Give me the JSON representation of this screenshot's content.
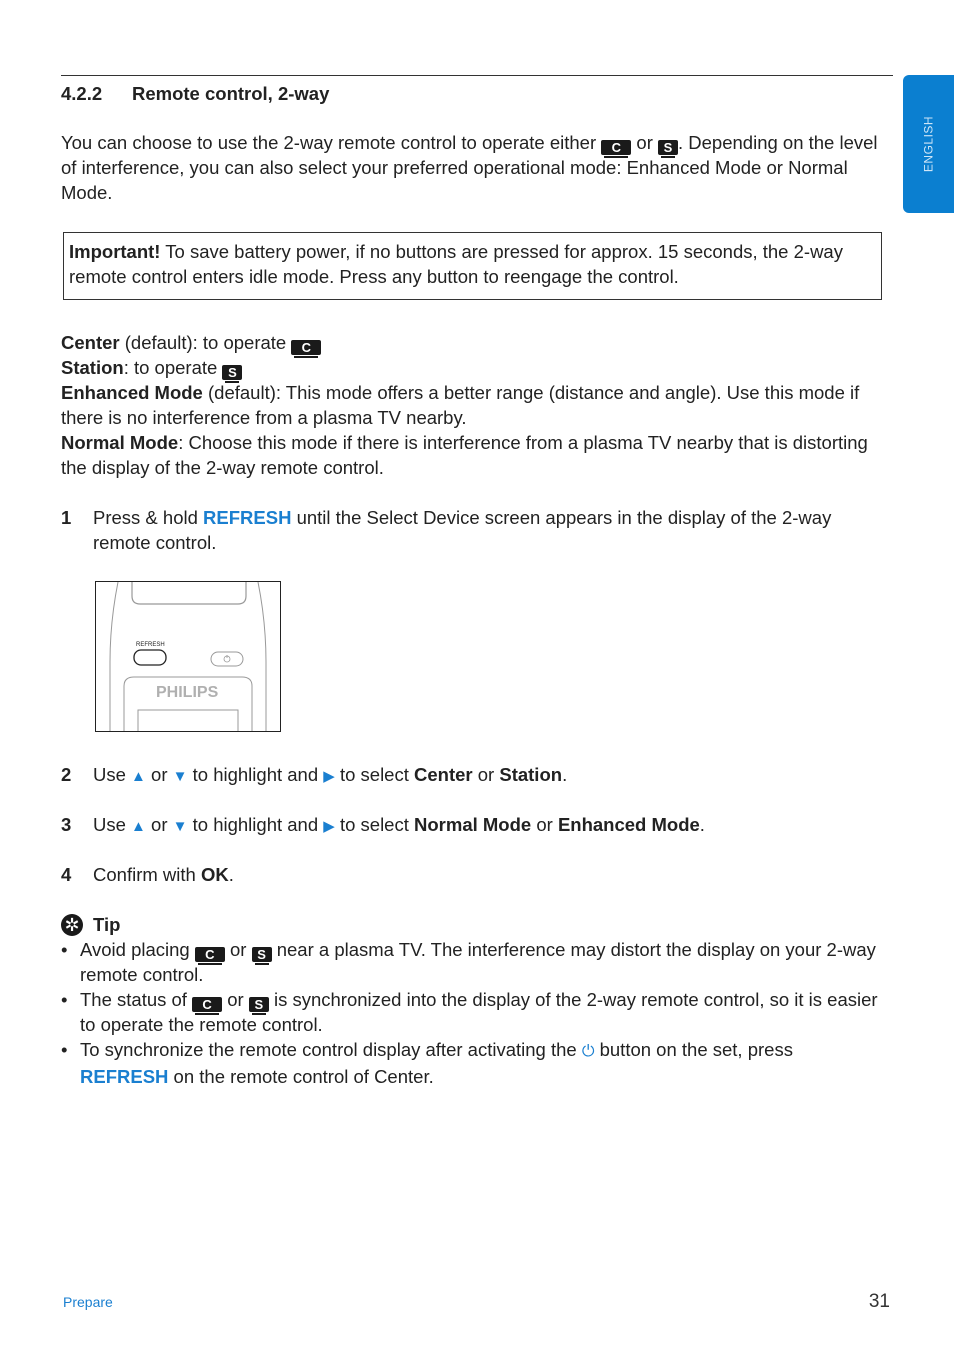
{
  "section": {
    "number": "4.2.2",
    "title": "Remote control, 2-way"
  },
  "language_tab": "ENGLISH",
  "intro": {
    "part1": "You can choose to use the 2-way remote control to operate either",
    "or": "or",
    "part2": ". Depending on the level of interference, you can also select your preferred operational mode: Enhanced Mode or Normal Mode."
  },
  "icons": {
    "center_icon": "C",
    "station_icon": "S",
    "tip_icon": "✲",
    "power_icon": "⏻"
  },
  "important": {
    "label": "Important!",
    "text": " To save battery power, if no buttons are pressed for approx. 15 seconds, the 2-way remote control enters idle mode. Press any button to reengage the control."
  },
  "definitions": {
    "center_label": "Center",
    "center_text": " (default): to operate ",
    "station_label": "Station",
    "station_text": ": to operate ",
    "enhanced_label": "Enhanced Mode",
    "enhanced_text": " (default): This mode offers a better range (distance and angle). Use this mode if there is no interference from a plasma TV nearby.",
    "normal_label": "Normal Mode",
    "normal_text": ": Choose this mode if there is interference from a plasma TV nearby that is distorting the display of the 2-way remote control."
  },
  "steps": [
    {
      "number": "1",
      "pre": "Press & hold ",
      "key": "REFRESH",
      "post": " until the Select Device screen appears in the display of the 2-way remote control."
    },
    {
      "number": "2",
      "use": "Use ",
      "up": "▲",
      "or": " or ",
      "down": "▼",
      "mid": " to highlight and ",
      "right": "▶",
      "select": " to select ",
      "opt1": "Center",
      "or2": " or ",
      "opt2": "Station",
      "end": "."
    },
    {
      "number": "3",
      "use": "Use ",
      "up": "▲",
      "or": " or ",
      "down": "▼",
      "mid": " to highlight and ",
      "right": "▶",
      "select": " to select ",
      "opt1": "Normal Mode",
      "or2": " or ",
      "opt2": "Enhanced Mode",
      "end": "."
    },
    {
      "number": "4",
      "pre": "Confirm with ",
      "key": "OK",
      "end": "."
    }
  ],
  "figure": {
    "refresh_label": "REFRESH",
    "brand": "PHILIPS"
  },
  "tip": {
    "title": "Tip",
    "items": [
      {
        "pre": "Avoid placing ",
        "or": " or ",
        "post": " near a plasma TV. The interference may distort the display on your 2-way remote control."
      },
      {
        "pre": "The status of ",
        "or": " or ",
        "post": " is synchronized into the display of the 2-way remote control, so it is easier to operate the remote control."
      },
      {
        "pre": "To synchronize the remote control display after activating the ",
        "post": " button on the set, press ",
        "key": "REFRESH",
        "end": " on the remote control of Center."
      }
    ]
  },
  "footer": {
    "section": "Prepare",
    "page": "31"
  }
}
